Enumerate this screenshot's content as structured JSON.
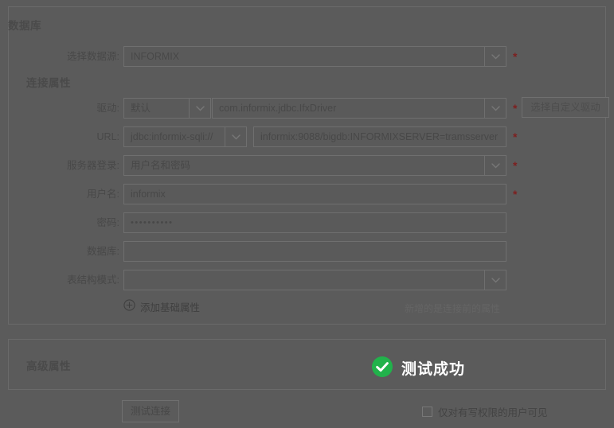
{
  "cards": {
    "database_title": "数据库",
    "connection_title": "连接属性",
    "advanced_title": "高级属性"
  },
  "form": {
    "datasource": {
      "label": "选择数据源:",
      "value": "INFORMIX",
      "required_mark": "*",
      "caret_icon": "chevron-down-icon"
    },
    "driver": {
      "label": "驱动:",
      "mode_value": "默认",
      "class_value": "com.informix.jdbc.IfxDriver",
      "required_mark": "*",
      "custom_button": "选择自定义驱动"
    },
    "url": {
      "label": "URL:",
      "scheme_value": "jdbc:informix-sqli://",
      "rest_value": "informix:9088/bigdb:INFORMIXSERVER=tramsserver",
      "required_mark": "*"
    },
    "server_login": {
      "label": "服务器登录:",
      "value": "用户名和密码",
      "required_mark": "*"
    },
    "username": {
      "label": "用户名:",
      "value": "informix",
      "required_mark": "*"
    },
    "password": {
      "label": "密码:",
      "value": "••••••••••"
    },
    "database": {
      "label": "数据库:",
      "value": ""
    },
    "schema": {
      "label": "表结构模式:",
      "value": ""
    },
    "add_property": {
      "label": "添加基础属性",
      "icon": "plus-circle-icon"
    },
    "hint": "新增的是连接前的属性"
  },
  "footer": {
    "test_connection": "测试连接",
    "visible_checkbox_label": "仅对有写权限的用户可见",
    "checkbox_checked": false
  },
  "toast": {
    "message": "测试成功",
    "icon": "check-circle-icon",
    "icon_color": "#21b24b",
    "text_color": "#ffffff"
  },
  "colors": {
    "page_background": "#5b5b5b",
    "card_border": "#6a6a6a",
    "field_border": "#6f6f6f",
    "required_asterisk": "#7d2020",
    "success_green": "#21b24b"
  }
}
